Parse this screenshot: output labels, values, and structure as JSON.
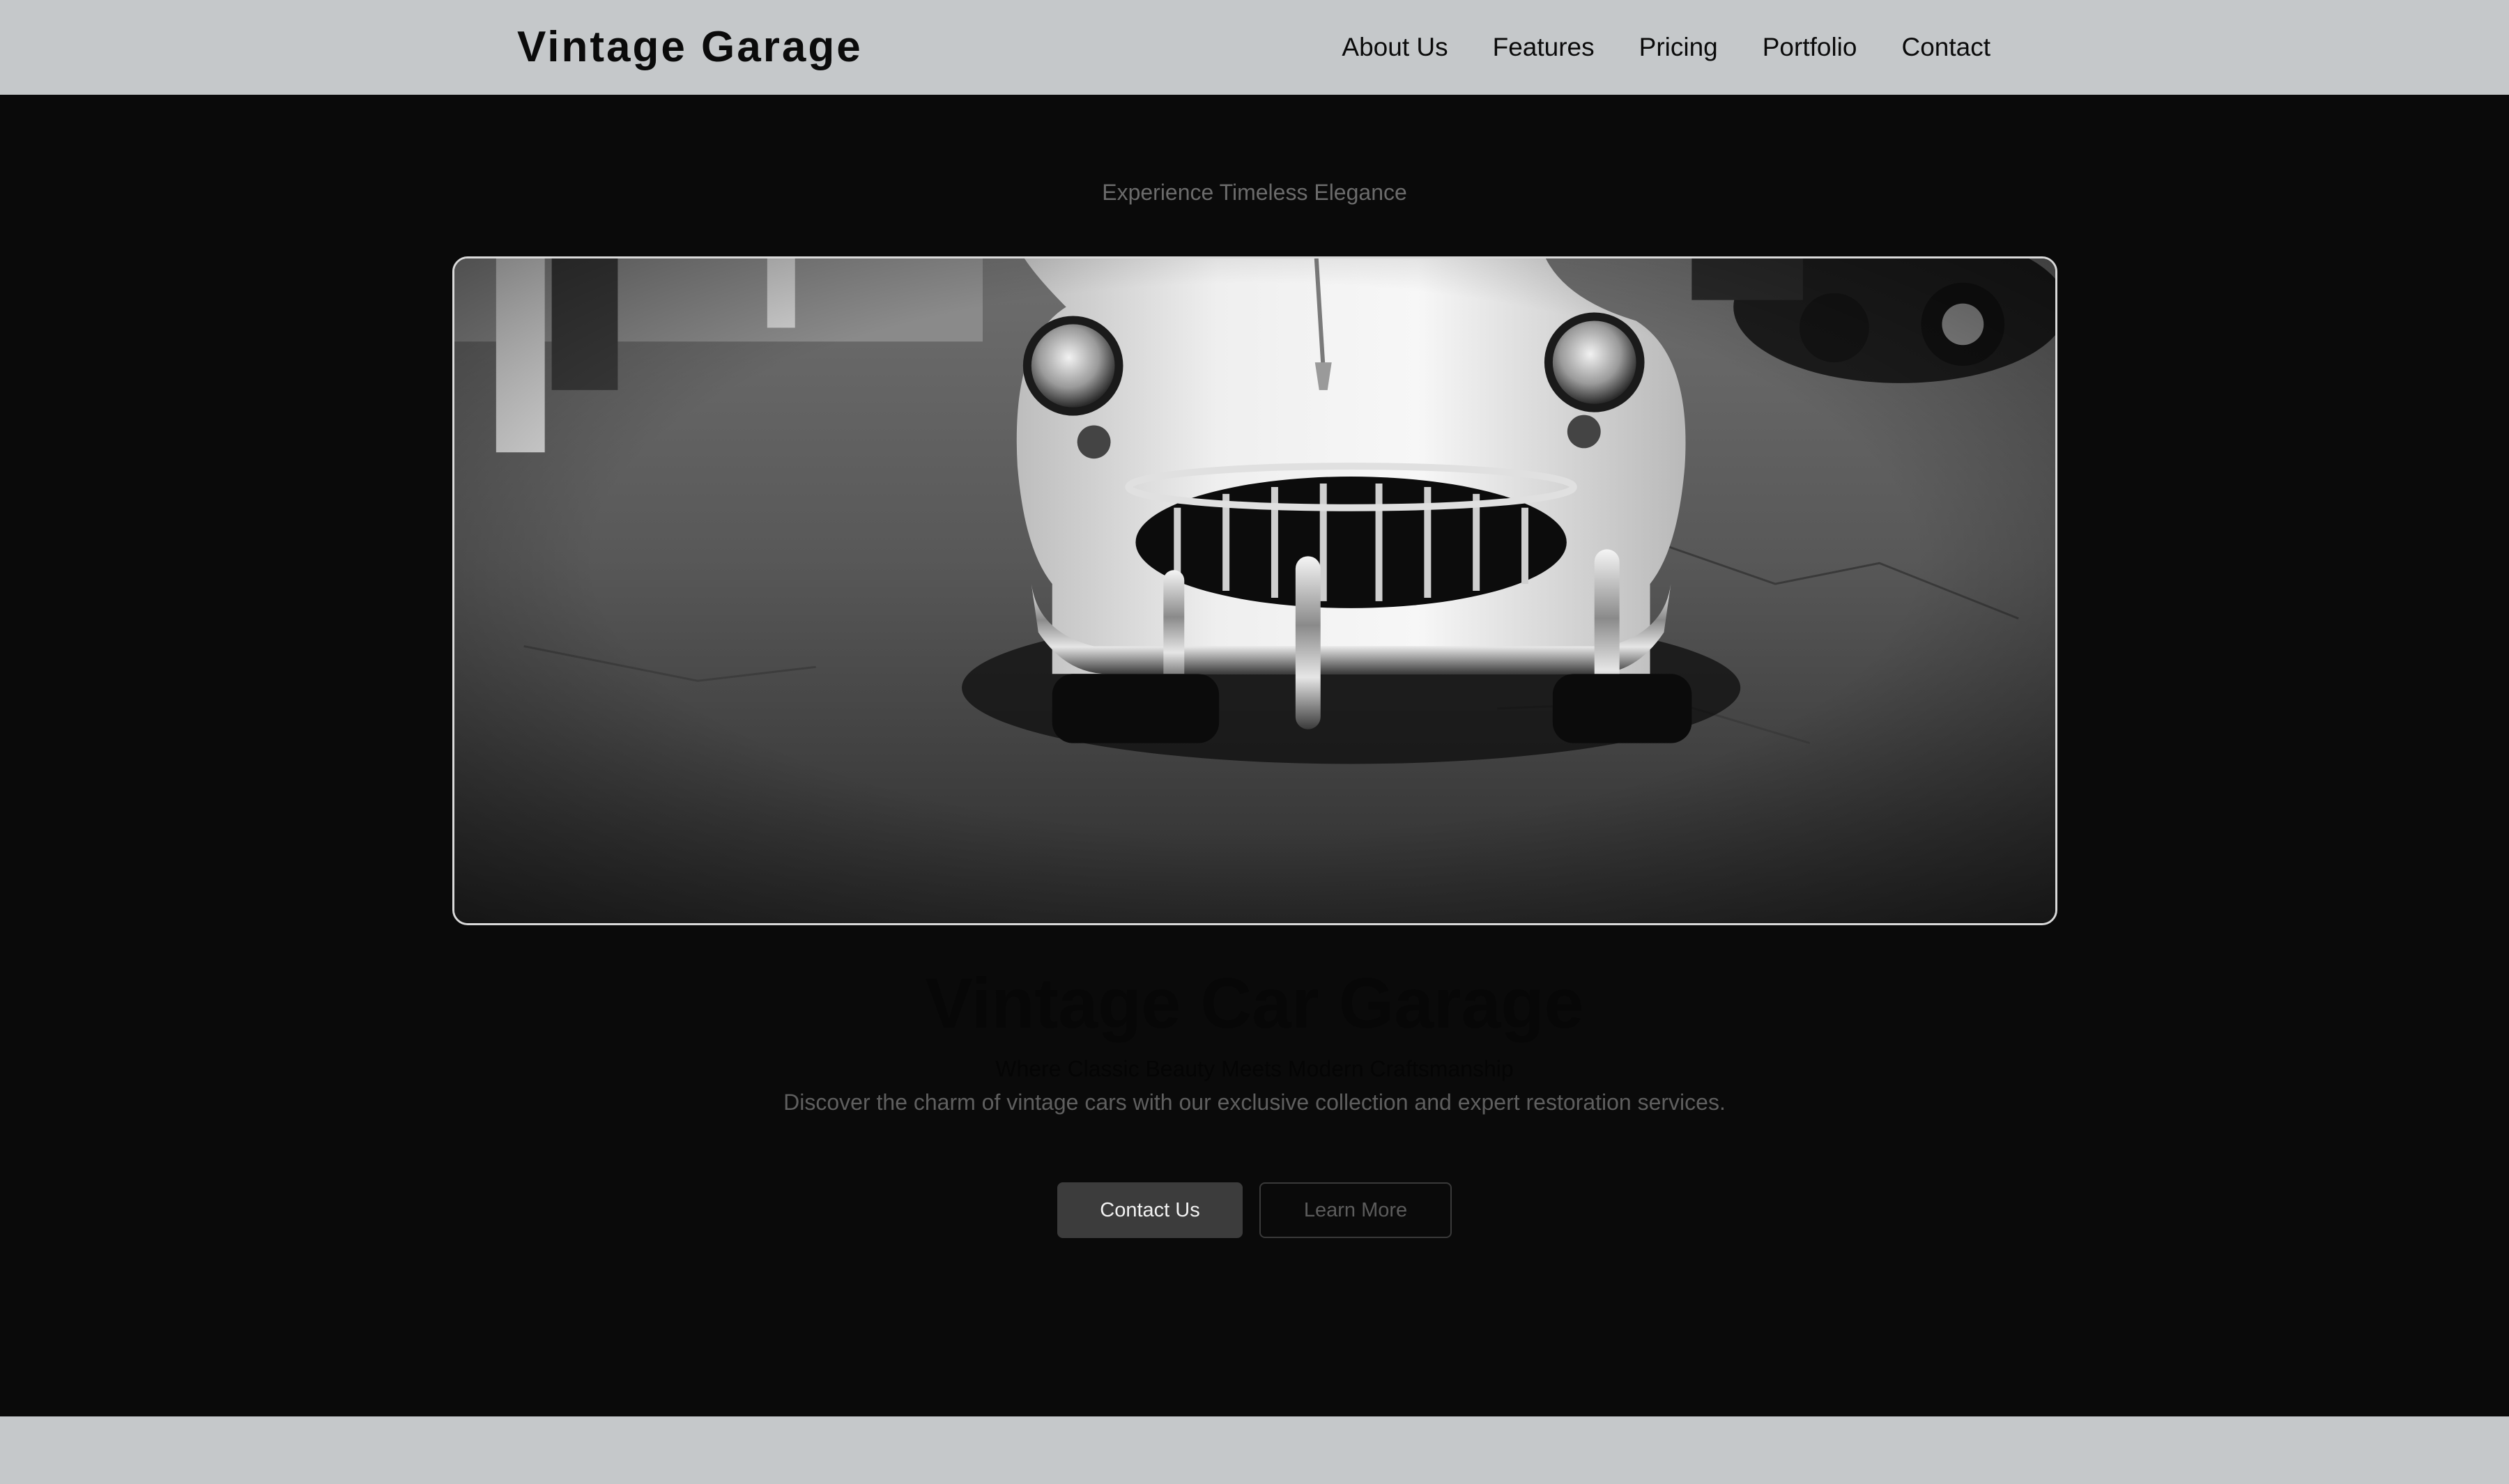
{
  "header": {
    "brand": "Vintage Garage",
    "nav": [
      {
        "label": "About Us"
      },
      {
        "label": "Features"
      },
      {
        "label": "Pricing"
      },
      {
        "label": "Portfolio"
      },
      {
        "label": "Contact"
      }
    ]
  },
  "hero": {
    "kicker": "Experience Timeless Elegance",
    "image_alt": "Black and white photo of a vintage car front in a garage",
    "title": "Vintage Car Garage",
    "subtitle": "Where Classic Beauty Meets Modern Craftsmanship",
    "description": "Discover the charm of vintage cars with our exclusive collection and expert restoration services.",
    "primary_button": "Contact Us",
    "secondary_button": "Learn More"
  },
  "colors": {
    "header_bg": "#c5c8ca",
    "hero_bg": "#0a0a0a",
    "primary_button_bg": "#3c3c3c"
  }
}
